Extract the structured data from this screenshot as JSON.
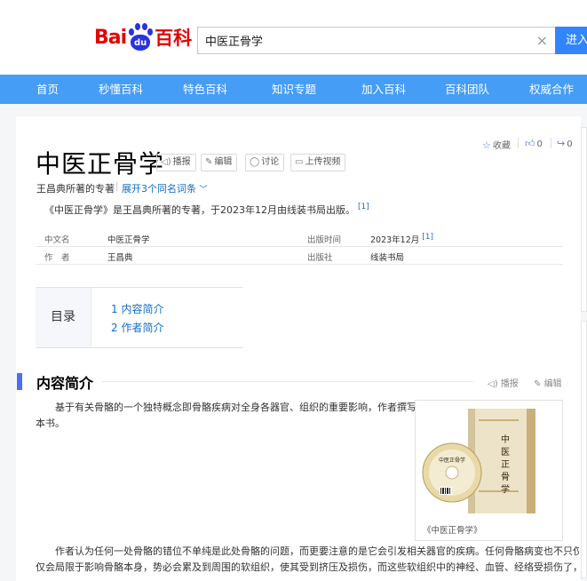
{
  "header": {
    "logo": {
      "left": "Bai",
      "paw": "du",
      "right": "百科"
    },
    "search": {
      "value": "中医正骨学",
      "clear": "×",
      "button": "进入"
    }
  },
  "nav": {
    "items": [
      "首页",
      "秒懂百科",
      "特色百科",
      "知识专题",
      "加入百科",
      "百科团队",
      "权威合作"
    ]
  },
  "entry": {
    "title": "中医正骨学",
    "tools": [
      {
        "icon": "speaker-icon",
        "label": "播报"
      },
      {
        "icon": "edit-icon",
        "label": "编辑"
      },
      {
        "icon": "comment-icon",
        "label": "讨论"
      },
      {
        "icon": "video-icon",
        "label": "上传视频"
      }
    ],
    "favorite": "收藏",
    "likes": "0",
    "shares": "0",
    "subtitle": "王昌典所著的专著",
    "expand": "展开3个同名词条",
    "summary": "《中医正骨学》是王昌典所著的专著，于2023年12月由线装书局出版。",
    "summary_ref": "[1]"
  },
  "info": [
    {
      "label": "中文名",
      "value": "中医正骨学",
      "label2": "出版时间",
      "value2": "2023年12月",
      "ref2": "[1]"
    },
    {
      "label": "作　者",
      "value": "王昌典",
      "label2": "出版社",
      "value2": "线装书局",
      "ref2": ""
    }
  ],
  "toc": {
    "head": "目录",
    "items": [
      "1  内容简介",
      "2  作者简介"
    ]
  },
  "section": {
    "title": "内容简介",
    "read_label": "播报",
    "edit_label": "编辑",
    "para1a": "基于有关骨骼的一个独特概念即骨骼疾病对全身各器官、组织的重要影响，作者撰写",
    "para1b": "本书。",
    "para2a": "作者认为任何一处骨骼的错位不单纯是此处骨骼的问题，而更要注意的是它会引发相关器官的疾病。任何骨骼病变也不只仅",
    "para2b": "仅会局限于影响骨骼本身，势必会累及到周围的软组织，使其受到挤压及损伤，而这些软组织中的神经、血管、经络受损伤了，",
    "figure_caption": "《中医正骨学》",
    "book_title": "中医正骨学"
  },
  "colors": {
    "nav": "#459df5",
    "link": "#136ec2",
    "brand_red": "#e10601",
    "brand_blue": "#2932e1",
    "accent": "#4e6ef2"
  }
}
